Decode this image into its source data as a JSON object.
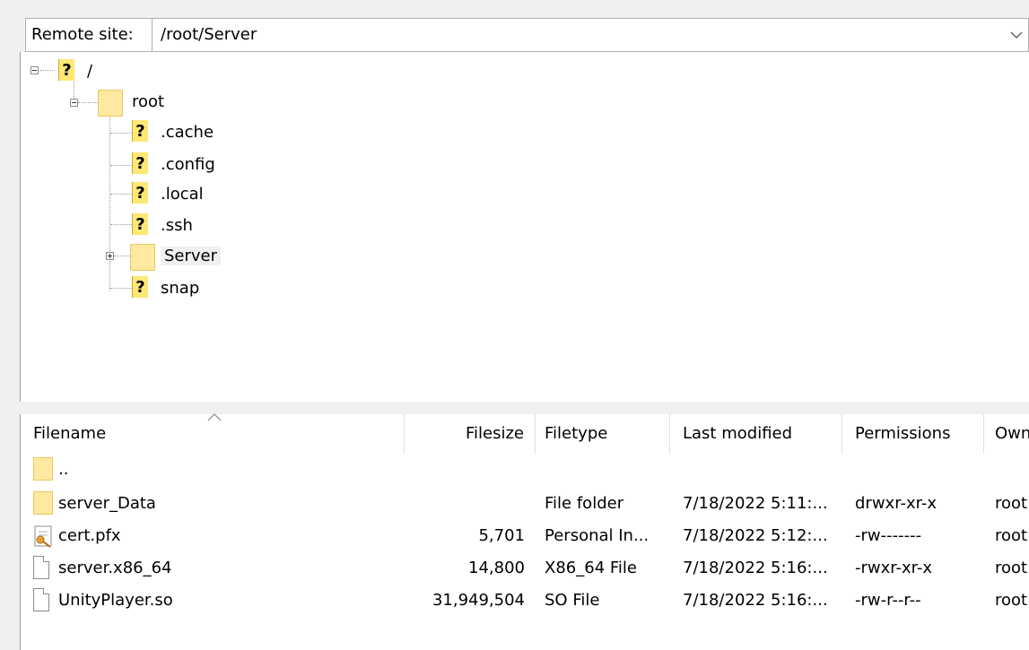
{
  "remote_site": {
    "label": "Remote site:",
    "path": "/root/Server"
  },
  "tree": {
    "nodes": [
      {
        "label": "/",
        "icon": "unknown-icon"
      },
      {
        "label": "root",
        "icon": "folder-icon"
      },
      {
        "label": ".cache",
        "icon": "unknown-icon"
      },
      {
        "label": ".config",
        "icon": "unknown-icon"
      },
      {
        "label": ".local",
        "icon": "unknown-icon"
      },
      {
        "label": ".ssh",
        "icon": "unknown-icon"
      },
      {
        "label": "Server",
        "icon": "folder-icon"
      },
      {
        "label": "snap",
        "icon": "unknown-icon"
      }
    ]
  },
  "file_list": {
    "columns": [
      "Filename",
      "Filesize",
      "Filetype",
      "Last modified",
      "Permissions",
      "Owner"
    ],
    "rows": [
      {
        "name": "..",
        "size": "",
        "type": "",
        "modified": "",
        "perms": "",
        "owner": "",
        "icon": "folder-icon"
      },
      {
        "name": "server_Data",
        "size": "",
        "type": "File folder",
        "modified": "7/18/2022 5:11:...",
        "perms": "drwxr-xr-x",
        "owner": "root",
        "icon": "folder-icon"
      },
      {
        "name": "cert.pfx",
        "size": "5,701",
        "type": "Personal In...",
        "modified": "7/18/2022 5:12:...",
        "perms": "-rw-------",
        "owner": "root",
        "icon": "certificate-icon"
      },
      {
        "name": "server.x86_64",
        "size": "14,800",
        "type": "X86_64 File",
        "modified": "7/18/2022 5:16:...",
        "perms": "-rwxr-xr-x",
        "owner": "root",
        "icon": "file-icon"
      },
      {
        "name": "UnityPlayer.so",
        "size": "31,949,504",
        "type": "SO File",
        "modified": "7/18/2022 5:16:...",
        "perms": "-rw-r--r--",
        "owner": "root",
        "icon": "file-icon"
      }
    ]
  }
}
